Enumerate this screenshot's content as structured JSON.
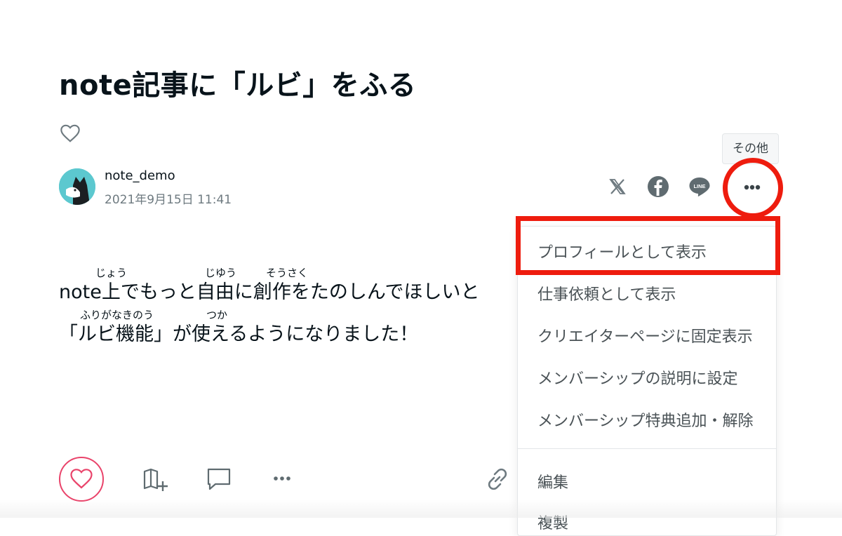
{
  "article": {
    "title": "note記事に「ルビ」をふる",
    "author_name": "note_demo",
    "published": "2021年9月15日 11:41",
    "body_lines": [
      "note上でもっと自由に創作をたのしんでほしいと",
      "「ルビ機能」が使えるようになりました！"
    ],
    "ruby": {
      "line1": [
        "じょう",
        "じゆう",
        "そうさく"
      ],
      "line2": [
        "ふりがなきのう",
        "つか"
      ]
    }
  },
  "share": {
    "tooltip": "その他",
    "icons": [
      "x-icon",
      "facebook-icon",
      "line-icon",
      "more-icon"
    ],
    "line_label": "LINE"
  },
  "menu": {
    "items": [
      "プロフィールとして表示",
      "仕事依頼として表示",
      "クリエイターページに固定表示",
      "メンバーシップの説明に設定",
      "メンバーシップ特典追加・解除"
    ],
    "secondary_items": [
      "編集",
      "複製"
    ]
  },
  "colors": {
    "highlight": "#ee1c0e",
    "like": "#e9436a",
    "avatar_bg": "#5cc8cf",
    "text": "#08131a",
    "muted": "#6e7a80"
  }
}
